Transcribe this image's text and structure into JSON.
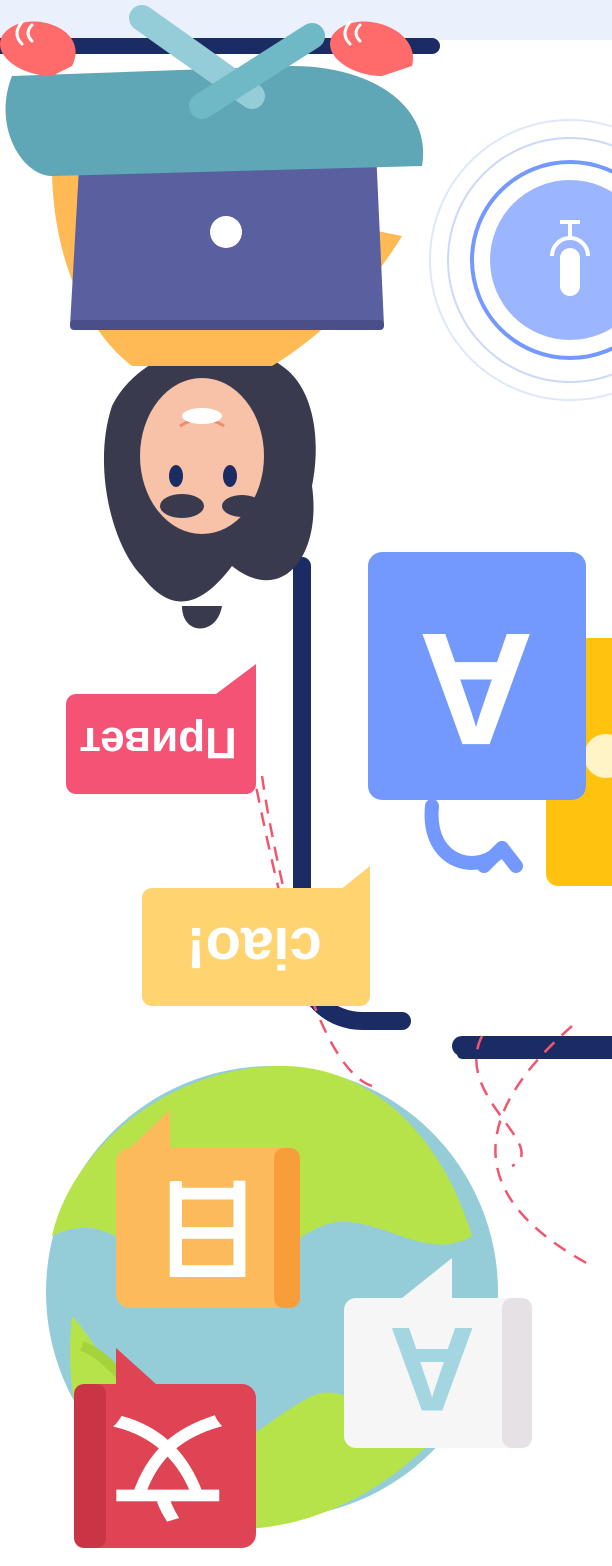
{
  "illustration": {
    "orientation": "rotated-180",
    "colors": {
      "navy": "#1b2c64",
      "blue": "#7399ff",
      "yellow": "#ffc20e",
      "pink": "#f55375",
      "light_yellow": "#ffd36f",
      "orange": "#fca948",
      "red": "#df4454",
      "globe_water": "#94cdd8",
      "globe_land": "#b7e34a"
    },
    "bubbles": {
      "russian": "Привет",
      "italian": "ciao!",
      "chinese": "日",
      "letter_a": "A",
      "letter_a_white": "A",
      "japanese": "文"
    },
    "icons": [
      "microphone-icon",
      "laptop-icon",
      "globe-icon",
      "translate-arrow-icon"
    ]
  }
}
